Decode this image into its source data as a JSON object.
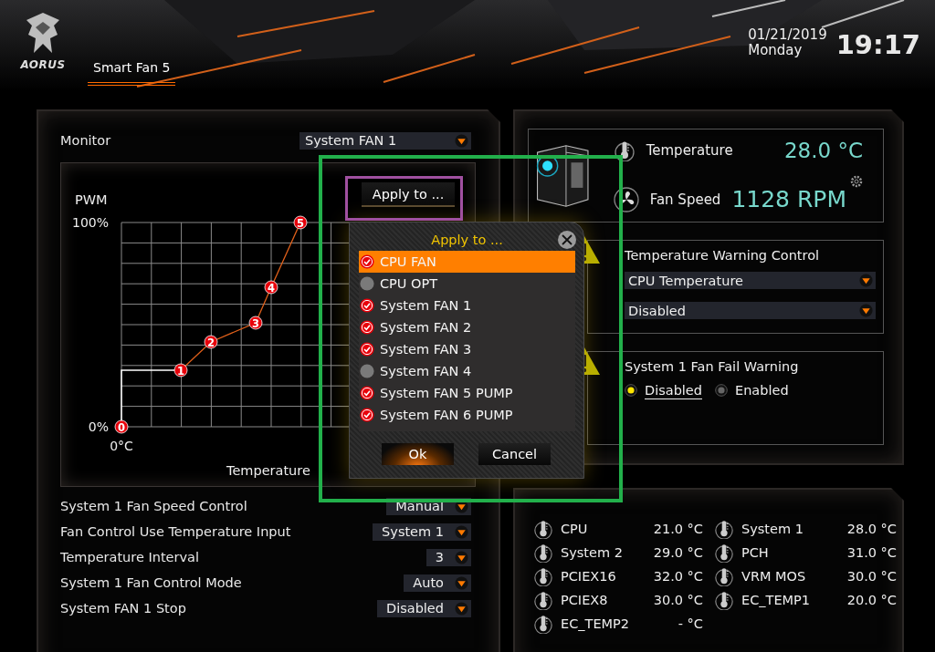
{
  "header": {
    "logo_text": "AORUS",
    "tabs": [
      {
        "label": "Smart Fan 5",
        "selected": true
      }
    ],
    "date": "01/21/2019",
    "weekday": "Monday",
    "time": "19:17"
  },
  "monitor": {
    "label": "Monitor",
    "value": "System FAN 1"
  },
  "curve": {
    "ylabel": "PWM",
    "y_max": "100%",
    "y_min": "0%",
    "x_min": "0°C",
    "xlabel": "Temperature",
    "points": [
      "0",
      "1",
      "2",
      "3",
      "4",
      "5"
    ]
  },
  "apply_button": "Apply to ...",
  "settings": [
    {
      "label": "System 1 Fan Speed Control",
      "value": "Manual"
    },
    {
      "label": "Fan Control Use Temperature Input",
      "value": "System 1"
    },
    {
      "label": "Temperature Interval",
      "value": "3"
    },
    {
      "label": "System 1 Fan Control Mode",
      "value": "Auto"
    },
    {
      "label": "System FAN 1 Stop",
      "value": "Disabled"
    }
  ],
  "status": {
    "temperature_label": "Temperature",
    "temperature": "28.0 °C",
    "fan_label": "Fan Speed",
    "fan_speed": "1128 RPM"
  },
  "temp_warning": {
    "title": "Temperature Warning Control",
    "source": "CPU Temperature",
    "value": "Disabled"
  },
  "fail_warning": {
    "title": "System 1 Fan Fail Warning",
    "options": [
      {
        "label": "Disabled",
        "selected": true
      },
      {
        "label": "Enabled",
        "selected": false
      }
    ]
  },
  "sensors": [
    {
      "name": "CPU",
      "value": "21.0 °C"
    },
    {
      "name": "System 1",
      "value": "28.0 °C"
    },
    {
      "name": "System 2",
      "value": "29.0 °C"
    },
    {
      "name": "PCH",
      "value": "31.0 °C"
    },
    {
      "name": "PCIEX16",
      "value": "32.0 °C"
    },
    {
      "name": "VRM MOS",
      "value": "30.0 °C"
    },
    {
      "name": "PCIEX8",
      "value": "30.0 °C"
    },
    {
      "name": "EC_TEMP1",
      "value": "20.0 °C"
    },
    {
      "name": "EC_TEMP2",
      "value": "- °C"
    }
  ],
  "dialog": {
    "title": "Apply to ...",
    "items": [
      {
        "label": "CPU FAN",
        "checked": true,
        "selected": true
      },
      {
        "label": "CPU OPT",
        "checked": false,
        "selected": false
      },
      {
        "label": "System FAN 1",
        "checked": true,
        "selected": false
      },
      {
        "label": "System FAN 2",
        "checked": true,
        "selected": false
      },
      {
        "label": "System FAN 3",
        "checked": true,
        "selected": false
      },
      {
        "label": "System FAN 4",
        "checked": false,
        "selected": false
      },
      {
        "label": "System FAN 5 PUMP",
        "checked": true,
        "selected": false
      },
      {
        "label": "System FAN 6 PUMP",
        "checked": true,
        "selected": false
      }
    ],
    "buttons": [
      {
        "label": "Ok",
        "kind": "primary"
      },
      {
        "label": "Cancel",
        "kind": "secondary"
      }
    ]
  }
}
